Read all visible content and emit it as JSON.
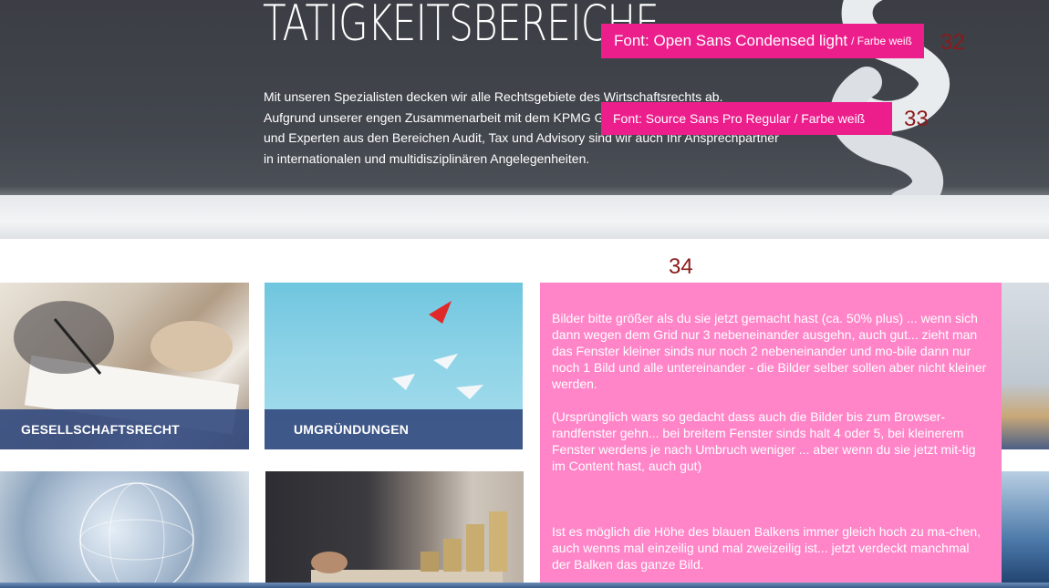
{
  "hero": {
    "title": "TÄTIGKEITSBEREICHE",
    "text_lines": [
      "Mit unseren Spezialisten decken wir alle Rechtsgebiete des Wirtschaftsrechts ab.",
      "Aufgrund unserer engen Zusammenarbeit mit dem KPMG Global Network",
      "und Experten aus den Bereichen Audit, Tax und Advisory sind wir auch Ihr Ansprechpartner",
      "in internationalen und multidisziplinären Angelegenheiten."
    ]
  },
  "annotations": {
    "a32": {
      "prefix": "Font:",
      "font": "Open Sans Condensed light",
      "suffix": "/ Farbe weiß",
      "number": "32"
    },
    "a33": {
      "prefix": "Font:",
      "font": "Source Sans Pro Regular / Farbe weiß",
      "number": "33"
    },
    "a34": {
      "number": "34"
    }
  },
  "tiles": [
    {
      "label": "GESELLSCHAFTSRECHT"
    },
    {
      "label": "UMGRÜNDUNGEN"
    }
  ],
  "note": {
    "paragraph_1": "Bilder bitte größer als du sie jetzt gemacht hast (ca. 50% plus) ... wenn sich dann wegen dem Grid nur 3 nebeneinander ausgehn, auch gut... zieht man das Fenster kleiner sinds nur noch 2 nebeneinander und mo-bile dann nur noch 1 Bild und alle untereinander - die Bilder selber sollen aber nicht kleiner werden.",
    "paragraph_2": "(Ursprünglich wars so gedacht dass auch die Bilder bis zum Browser-randfenster gehn... bei breitem Fenster sinds halt 4 oder 5, bei kleinerem Fenster werdens je nach Umbruch weniger ... aber wenn du sie jetzt mit-tig im Content hast, auch gut)",
    "paragraph_3": "Ist es möglich die Höhe des blauen Balkens immer gleich hoch zu ma-chen, auch wenns mal einzeilig und mal zweizeilig ist... jetzt verdeckt manchmal der Balken das ganze Bild."
  },
  "colors": {
    "annotation_pink": "#ec1e8c",
    "note_pink": "#ff85c8",
    "tile_bar_blue": "#354c80",
    "annotation_number": "#8b1a1a"
  }
}
